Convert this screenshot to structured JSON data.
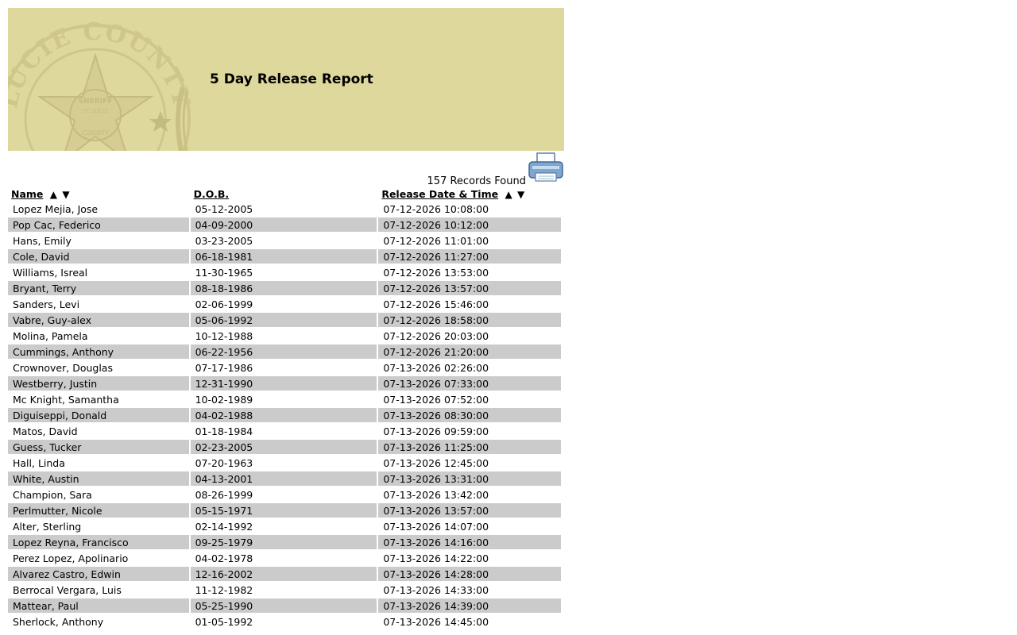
{
  "header": {
    "title": "5 Day Release Report",
    "seal_text_top": "LUCIE COUNTY",
    "seal_text_inner": "SHERIFF",
    "seal_text_inner2": "ST. LUCIE",
    "seal_text_bottom": "COUNTY",
    "banner_color": "#ded89c"
  },
  "summary": {
    "records_found": "157 Records Found",
    "print_icon": "printer-icon"
  },
  "table": {
    "headers": {
      "name": "Name",
      "dob": "D.O.B.",
      "release": "Release Date & Time",
      "sort_up": "▲",
      "sort_down": "▼"
    },
    "rows": [
      {
        "name": "Lopez Mejia, Jose",
        "dob": "05-12-2005",
        "release": "07-12-2026 10:08:00"
      },
      {
        "name": "Pop Cac, Federico",
        "dob": "04-09-2000",
        "release": "07-12-2026 10:12:00"
      },
      {
        "name": "Hans, Emily",
        "dob": "03-23-2005",
        "release": "07-12-2026 11:01:00"
      },
      {
        "name": "Cole, David",
        "dob": "06-18-1981",
        "release": "07-12-2026 11:27:00"
      },
      {
        "name": "Williams, Isreal",
        "dob": "11-30-1965",
        "release": "07-12-2026 13:53:00"
      },
      {
        "name": "Bryant, Terry",
        "dob": "08-18-1986",
        "release": "07-12-2026 13:57:00"
      },
      {
        "name": "Sanders, Levi",
        "dob": "02-06-1999",
        "release": "07-12-2026 15:46:00"
      },
      {
        "name": "Vabre, Guy-alex",
        "dob": "05-06-1992",
        "release": "07-12-2026 18:58:00"
      },
      {
        "name": "Molina, Pamela",
        "dob": "10-12-1988",
        "release": "07-12-2026 20:03:00"
      },
      {
        "name": "Cummings, Anthony",
        "dob": "06-22-1956",
        "release": "07-12-2026 21:20:00"
      },
      {
        "name": "Crownover, Douglas",
        "dob": "07-17-1986",
        "release": "07-13-2026 02:26:00"
      },
      {
        "name": "Westberry, Justin",
        "dob": "12-31-1990",
        "release": "07-13-2026 07:33:00"
      },
      {
        "name": "Mc Knight, Samantha",
        "dob": "10-02-1989",
        "release": "07-13-2026 07:52:00"
      },
      {
        "name": "Diguiseppi, Donald",
        "dob": "04-02-1988",
        "release": "07-13-2026 08:30:00"
      },
      {
        "name": "Matos, David",
        "dob": "01-18-1984",
        "release": "07-13-2026 09:59:00"
      },
      {
        "name": "Guess, Tucker",
        "dob": "02-23-2005",
        "release": "07-13-2026 11:25:00"
      },
      {
        "name": "Hall, Linda",
        "dob": "07-20-1963",
        "release": "07-13-2026 12:45:00"
      },
      {
        "name": "White, Austin",
        "dob": "04-13-2001",
        "release": "07-13-2026 13:31:00"
      },
      {
        "name": "Champion, Sara",
        "dob": "08-26-1999",
        "release": "07-13-2026 13:42:00"
      },
      {
        "name": "Perlmutter, Nicole",
        "dob": "05-15-1971",
        "release": "07-13-2026 13:57:00"
      },
      {
        "name": "Alter, Sterling",
        "dob": "02-14-1992",
        "release": "07-13-2026 14:07:00"
      },
      {
        "name": "Lopez Reyna, Francisco",
        "dob": "09-25-1979",
        "release": "07-13-2026 14:16:00"
      },
      {
        "name": "Perez Lopez, Apolinario",
        "dob": "04-02-1978",
        "release": "07-13-2026 14:22:00"
      },
      {
        "name": "Alvarez Castro, Edwin",
        "dob": "12-16-2002",
        "release": "07-13-2026 14:28:00"
      },
      {
        "name": "Berrocal Vergara, Luis",
        "dob": "11-12-1982",
        "release": "07-13-2026 14:33:00"
      },
      {
        "name": "Mattear, Paul",
        "dob": "05-25-1990",
        "release": "07-13-2026 14:39:00"
      },
      {
        "name": "Sherlock, Anthony",
        "dob": "01-05-1992",
        "release": "07-13-2026 14:45:00"
      }
    ],
    "row_alt_color": "#cbcbcb"
  }
}
